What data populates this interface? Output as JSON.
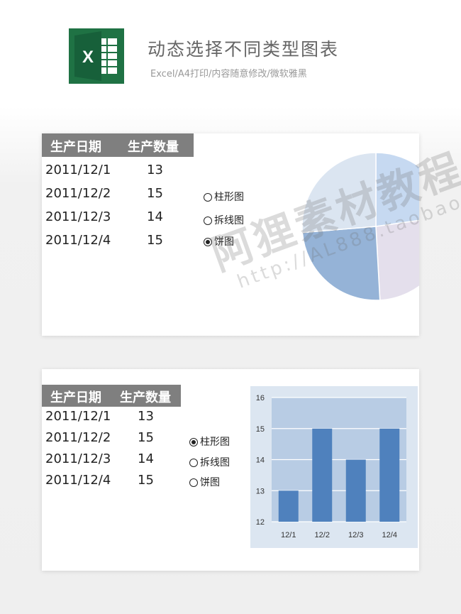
{
  "header": {
    "logo_letter": "X",
    "title": "动态选择不同类型图表",
    "subtitle": "Excel/A4打印/内容随意修改/微软雅黑"
  },
  "panel1": {
    "columns": [
      "生产日期",
      "生产数量"
    ],
    "rows": [
      {
        "date": "2011/12/1",
        "qty": "13"
      },
      {
        "date": "2011/12/2",
        "qty": "15"
      },
      {
        "date": "2011/12/3",
        "qty": "14"
      },
      {
        "date": "2011/12/4",
        "qty": "15"
      }
    ],
    "options": [
      {
        "label": "柱形图",
        "selected": false
      },
      {
        "label": "拆线图",
        "selected": false
      },
      {
        "label": "饼图",
        "selected": true
      }
    ]
  },
  "panel2": {
    "columns": [
      "生产日期",
      "生产数量"
    ],
    "rows": [
      {
        "date": "2011/12/1",
        "qty": "13"
      },
      {
        "date": "2011/12/2",
        "qty": "15"
      },
      {
        "date": "2011/12/3",
        "qty": "14"
      },
      {
        "date": "2011/12/4",
        "qty": "15"
      }
    ],
    "options": [
      {
        "label": "柱形图",
        "selected": true
      },
      {
        "label": "拆线图",
        "selected": false
      },
      {
        "label": "饼图",
        "selected": false
      }
    ]
  },
  "chart_data": [
    {
      "type": "pie",
      "categories": [
        "12/1",
        "12/2",
        "12/3",
        "12/4"
      ],
      "values": [
        13,
        15,
        14,
        15
      ],
      "colors": [
        "#c6d9f1",
        "#e4dfec",
        "#95b3d7",
        "#dbe5f1"
      ],
      "title": "",
      "legend": "none"
    },
    {
      "type": "bar",
      "categories": [
        "12/1",
        "12/2",
        "12/3",
        "12/4"
      ],
      "values": [
        13,
        15,
        14,
        15
      ],
      "title": "",
      "xlabel": "",
      "ylabel": "",
      "ylim": [
        12,
        16
      ],
      "yticks": [
        "12",
        "13",
        "14",
        "15",
        "16"
      ],
      "grid": true,
      "bar_color": "#4f81bd",
      "plot_bg": "#b8cce4",
      "chart_bg": "#dce6f1"
    }
  ],
  "watermark": {
    "main": "阿狸素材教程",
    "url": "http://AL888.taobao.com"
  },
  "colors": {
    "excel_green": "#1f7244",
    "header_gray": "#7f7f7f"
  }
}
